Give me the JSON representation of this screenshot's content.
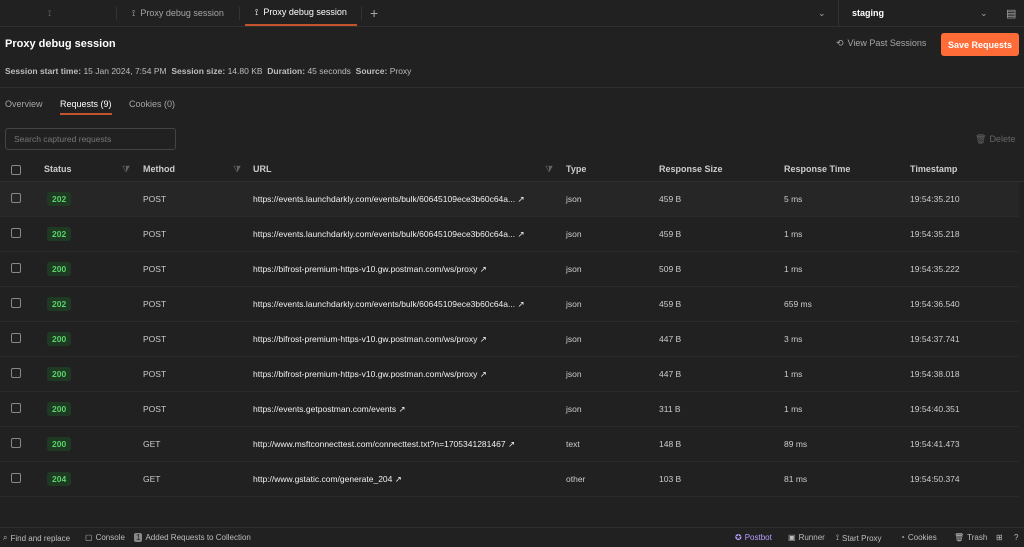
{
  "tabs": [
    {
      "label": ""
    },
    {
      "label": "Proxy debug session"
    },
    {
      "label": "Proxy debug session",
      "active": true
    }
  ],
  "new_tab": "+",
  "environment": "staging",
  "header": {
    "title": "Proxy debug session",
    "view_past": "View Past Sessions",
    "save": "Save Requests"
  },
  "meta": {
    "start_label": "Session start time:",
    "start": "15 Jan 2024, 7:54 PM",
    "size_label": "Session size:",
    "size": "14.80 KB",
    "duration_label": "Duration:",
    "duration": "45 seconds",
    "source_label": "Source:",
    "source": "Proxy"
  },
  "subtabs": [
    "Overview",
    "Requests (9)",
    "Cookies (0)"
  ],
  "search_placeholder": "Search captured requests",
  "delete": "Delete",
  "columns": [
    "Status",
    "Method",
    "URL",
    "Type",
    "Response Size",
    "Response Time",
    "Timestamp"
  ],
  "rows": [
    {
      "status": "202",
      "method": "POST",
      "url": "https://events.launchdarkly.com/events/bulk/60645109ece3b60c64a...",
      "type": "json",
      "size": "459 B",
      "time": "5 ms",
      "ts": "19:54:35.210"
    },
    {
      "status": "202",
      "method": "POST",
      "url": "https://events.launchdarkly.com/events/bulk/60645109ece3b60c64a...",
      "type": "json",
      "size": "459 B",
      "time": "1 ms",
      "ts": "19:54:35.218"
    },
    {
      "status": "200",
      "method": "POST",
      "url": "https://bifrost-premium-https-v10.gw.postman.com/ws/proxy",
      "type": "json",
      "size": "509 B",
      "time": "1 ms",
      "ts": "19:54:35.222"
    },
    {
      "status": "202",
      "method": "POST",
      "url": "https://events.launchdarkly.com/events/bulk/60645109ece3b60c64a...",
      "type": "json",
      "size": "459 B",
      "time": "659 ms",
      "ts": "19:54:36.540"
    },
    {
      "status": "200",
      "method": "POST",
      "url": "https://bifrost-premium-https-v10.gw.postman.com/ws/proxy",
      "type": "json",
      "size": "447 B",
      "time": "3 ms",
      "ts": "19:54:37.741"
    },
    {
      "status": "200",
      "method": "POST",
      "url": "https://bifrost-premium-https-v10.gw.postman.com/ws/proxy",
      "type": "json",
      "size": "447 B",
      "time": "1 ms",
      "ts": "19:54:38.018"
    },
    {
      "status": "200",
      "method": "POST",
      "url": "https://events.getpostman.com/events",
      "type": "json",
      "size": "311 B",
      "time": "1 ms",
      "ts": "19:54:40.351"
    },
    {
      "status": "200",
      "method": "GET",
      "url": "http://www.msftconnecttest.com/connecttest.txt?n=1705341281467",
      "type": "text",
      "size": "148 B",
      "time": "89 ms",
      "ts": "19:54:41.473"
    },
    {
      "status": "204",
      "method": "GET",
      "url": "http://www.gstatic.com/generate_204",
      "type": "other",
      "size": "103 B",
      "time": "81 ms",
      "ts": "19:54:50.374"
    }
  ],
  "statusbar": {
    "find": "Find and replace",
    "console": "Console",
    "added_count": "1",
    "added": "Added Requests to Collection",
    "postbot": "Postbot",
    "runner": "Runner",
    "proxy": "Start Proxy",
    "cookies": "Cookies",
    "trash": "Trash"
  }
}
